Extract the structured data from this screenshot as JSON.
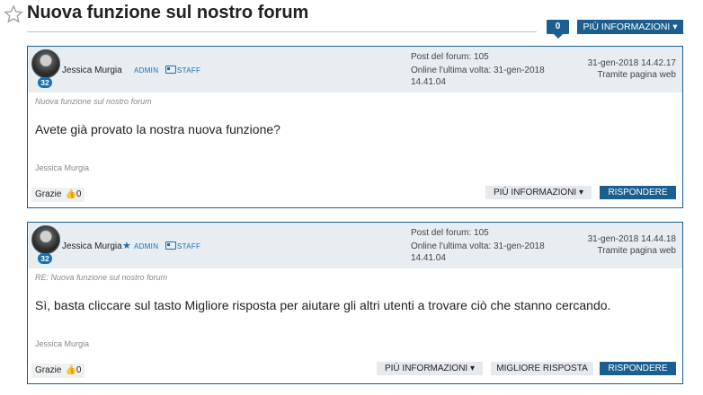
{
  "header": {
    "title": "Nuova funzione sul nostro forum",
    "reply_count": "0",
    "more_info_label": "PIÙ INFORMAZIONI ▾"
  },
  "posts": [
    {
      "author": "Jessica Murgia",
      "level": "32",
      "role_admin": "ADMIN",
      "role_staff": "STAFF",
      "posts_count": "Post del forum: 105",
      "last_online": "Online l'ultima volta: 31-gen-2018 14.41.04",
      "date": "31-gen-2018 14.42.17",
      "via": "Tramite pagina web",
      "subject": "Nuova funzione sul nostro forum",
      "body": "Avete già provato la nostra nuova funzione?",
      "signature": "Jessica Murgia",
      "thanks_label": "Grazie",
      "thanks_count": "0",
      "more_info_label": "PIÙ INFORMAZIONI ▾",
      "reply_label": "RISPONDERE"
    },
    {
      "author": "Jessica Murgia",
      "level": "32",
      "role_admin": "ADMIN",
      "role_staff": "STAFF",
      "posts_count": "Post del forum: 105",
      "last_online": "Online l'ultima volta: 31-gen-2018 14.41.04",
      "date": "31-gen-2018 14.44.18",
      "via": "Tramite pagina web",
      "subject": "RE: Nuova funzione sul nostro forum",
      "body": "Sì, basta cliccare sul tasto Migliore risposta per aiutare gli altri utenti a trovare ciò che stanno cercando.",
      "signature": "Jessica Murgia",
      "thanks_label": "Grazie",
      "thanks_count": "0",
      "more_info_label": "PIÙ INFORMAZIONI ▾",
      "best_answer_label": "MIGLIORE RISPOSTA",
      "reply_label": "RISPONDERE"
    }
  ]
}
